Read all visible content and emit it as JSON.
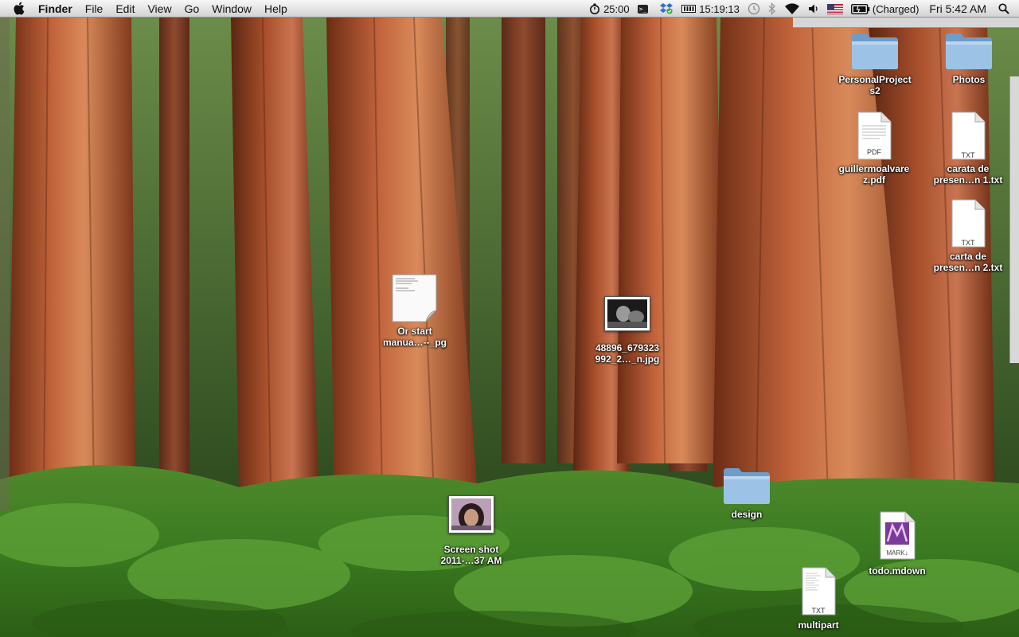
{
  "menubar": {
    "app_name": "Finder",
    "menus": [
      "File",
      "Edit",
      "View",
      "Go",
      "Window",
      "Help"
    ],
    "status": {
      "timer": "25:00",
      "terminal_chip": ">_",
      "battery_time": "15:19:13",
      "battery_state": "(Charged)",
      "clock": "Fri 5:42 AM"
    }
  },
  "icons": {
    "personal_projects": {
      "label_1": "PersonalProject",
      "label_2": "s2",
      "kind": "folder-icon"
    },
    "photos": {
      "label_1": "Photos",
      "kind": "folder-icon"
    },
    "resume_pdf": {
      "label_1": "guillermoalvare",
      "label_2": "z.pdf",
      "badge": "PDF"
    },
    "carata_1": {
      "label_1": "carata de",
      "label_2": "presen…n 1.txt",
      "badge": "TXT"
    },
    "carta_2": {
      "label_1": "carta de",
      "label_2": "presen…n 2.txt",
      "badge": "TXT"
    },
    "or_start": {
      "label_1": "Or start",
      "label_2": "manua…--_pg"
    },
    "photo_jpg": {
      "label_1": "48896_679323",
      "label_2": "992_2…_n.jpg"
    },
    "design": {
      "label_1": "design",
      "kind": "folder-icon"
    },
    "screenshot": {
      "label_1": "Screen shot",
      "label_2": "2011-…37 AM"
    },
    "todo": {
      "label_1": "todo.mdown",
      "badge": "MARK↓"
    },
    "multipart": {
      "label_1": "multipart",
      "badge": "TXT"
    }
  },
  "colors": {
    "folder_blue": "#8fb8dc",
    "menubar_bg": "#e6e6e6",
    "label_text": "#ffffff"
  }
}
